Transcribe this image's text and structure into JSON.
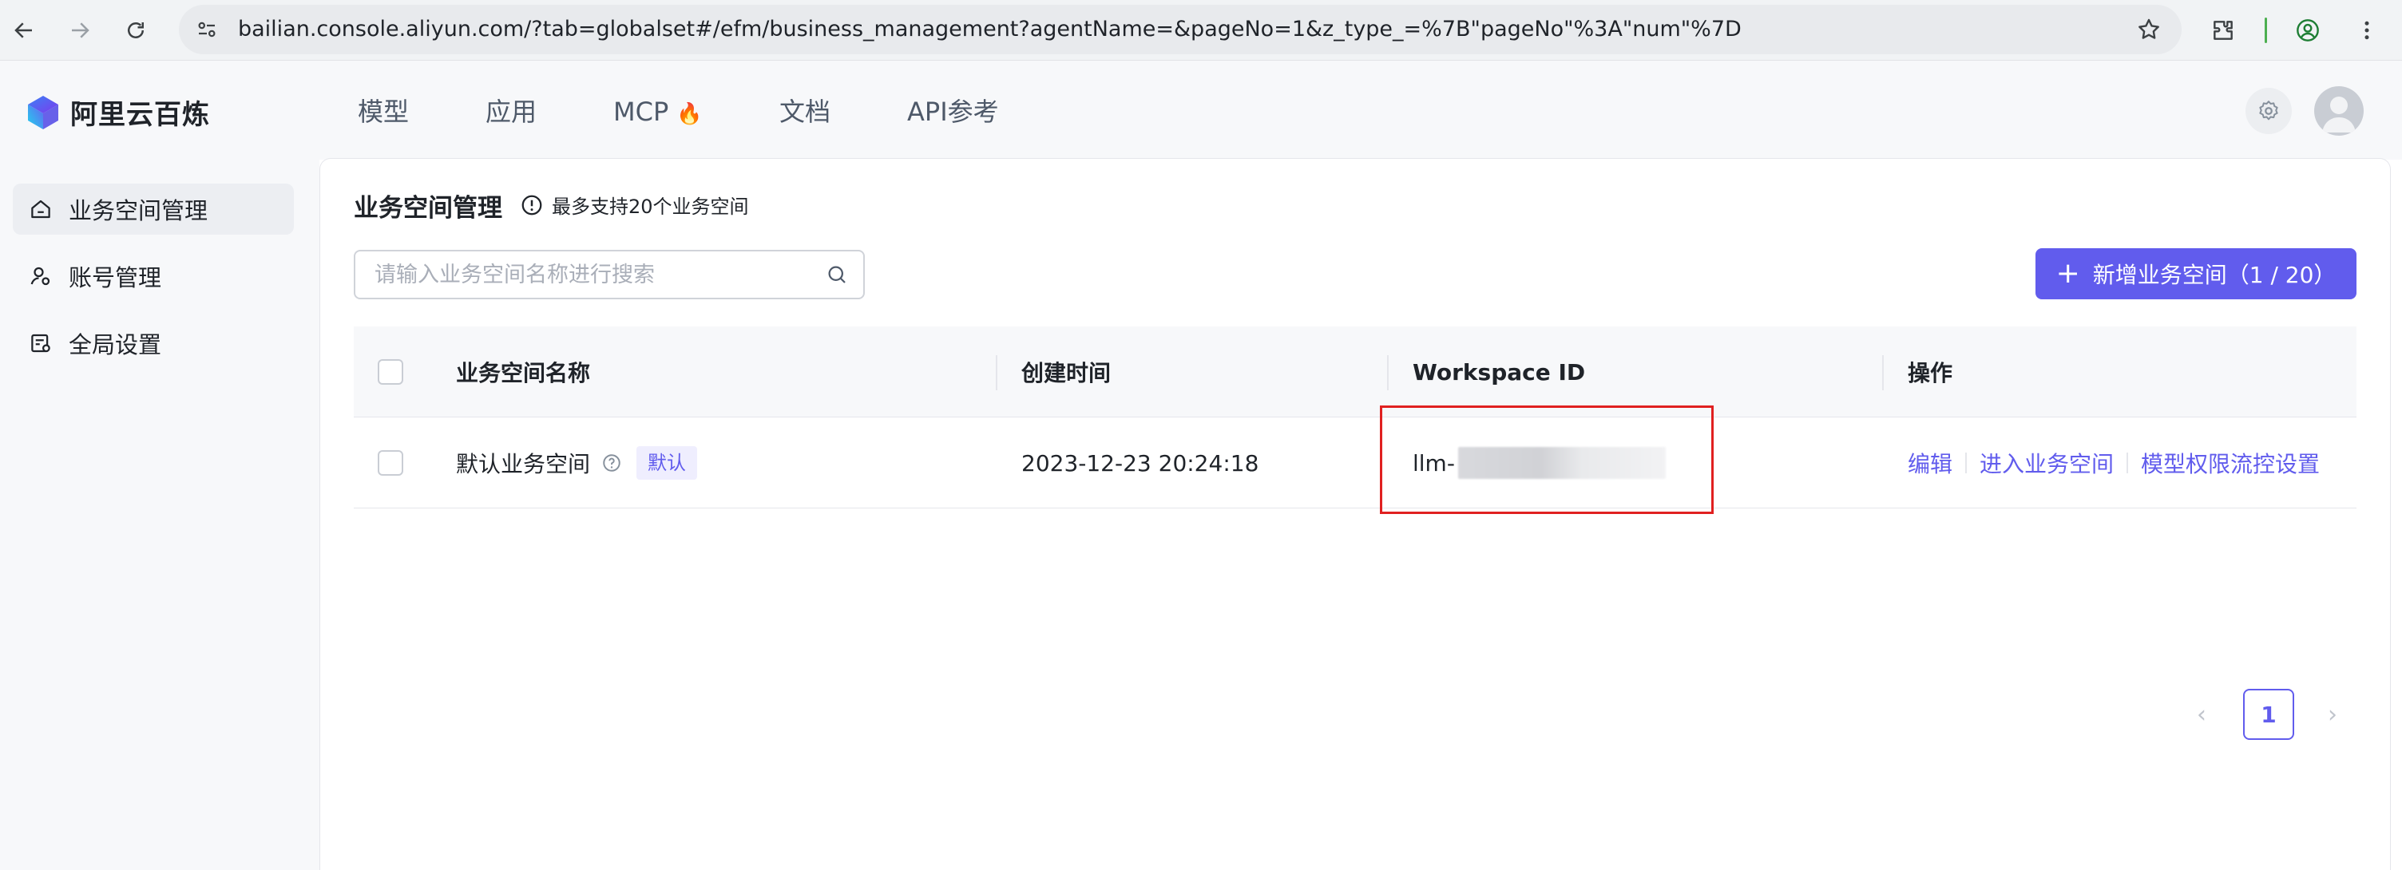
{
  "browser": {
    "url": "bailian.console.aliyun.com/?tab=globalset#/efm/business_management?agentName=&pageNo=1&z_type_=%7B\"pageNo\"%3A\"num\"%7D",
    "icons": [
      "back-arrow-icon",
      "forward-arrow-icon",
      "reload-icon",
      "site-settings-icon",
      "star-icon",
      "extensions-icon",
      "profile-icon",
      "more-vert-icon"
    ]
  },
  "header": {
    "brand": "阿里云百炼",
    "nav": [
      {
        "label": "模型"
      },
      {
        "label": "应用"
      },
      {
        "label": "MCP",
        "emoji": "🔥"
      },
      {
        "label": "文档"
      },
      {
        "label": "API参考"
      }
    ]
  },
  "sidebar": {
    "items": [
      {
        "label": "业务空间管理",
        "icon": "home-icon",
        "active": true
      },
      {
        "label": "账号管理",
        "icon": "user-settings-icon",
        "active": false
      },
      {
        "label": "全局设置",
        "icon": "global-settings-icon",
        "active": false
      }
    ]
  },
  "main": {
    "title": "业务空间管理",
    "hint": "最多支持20个业务空间",
    "search": {
      "placeholder": "请输入业务空间名称进行搜索",
      "value": ""
    },
    "add_button": "新增业务空间（1 / 20）",
    "table": {
      "columns": [
        "业务空间名称",
        "创建时间",
        "Workspace ID",
        "操作"
      ],
      "rows": [
        {
          "name": "默认业务空间",
          "tag": "默认",
          "created": "2023-12-23 20:24:18",
          "workspace_id_prefix": "llm-",
          "actions": [
            "编辑",
            "进入业务空间",
            "模型权限流控设置"
          ]
        }
      ]
    },
    "pagination": {
      "current": "1",
      "prev": "‹",
      "next": "›"
    }
  },
  "colors": {
    "accent": "#615ced",
    "highlight": "#e02020"
  }
}
